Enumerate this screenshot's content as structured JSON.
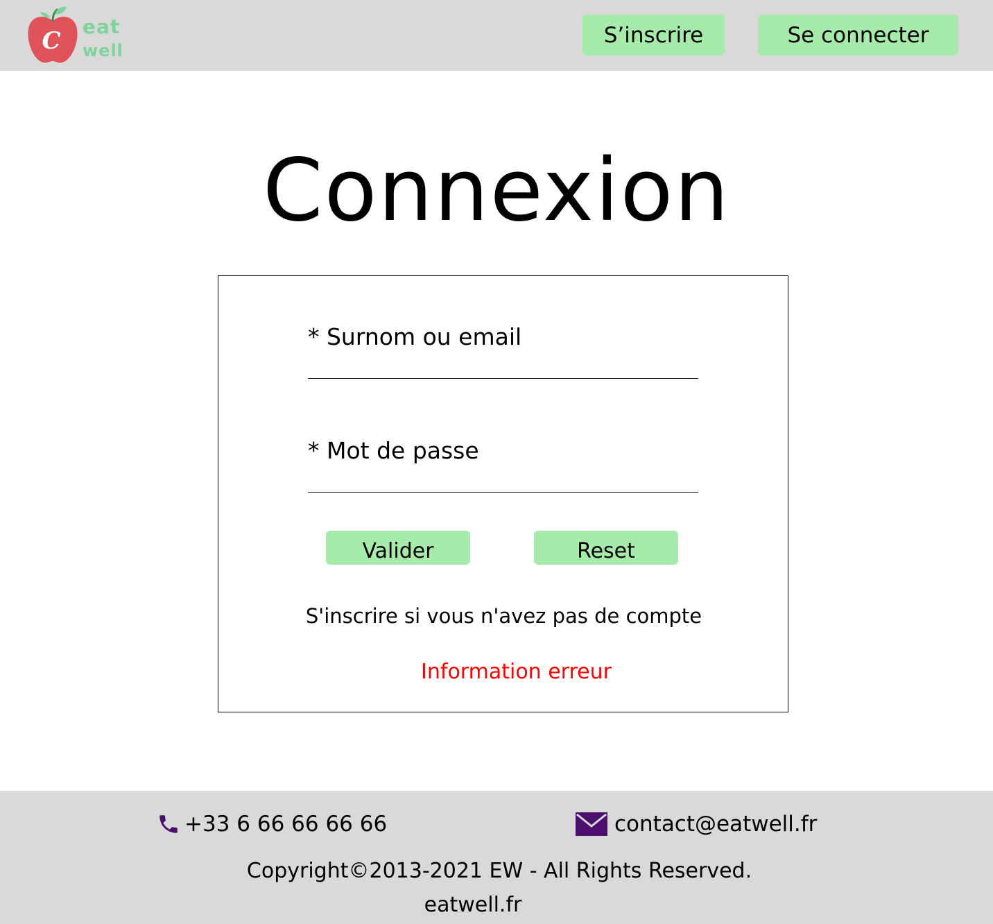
{
  "header": {
    "logo": {
      "line1": "eat",
      "line2": "well",
      "badge_letter": "C",
      "apple_color": "#e0525a",
      "leaf_color": "#7ed39a"
    },
    "nav": {
      "signup_label": "S’inscrire",
      "login_label": "Se connecter"
    },
    "button_color": "#a6ebaa",
    "background": "#d9d9d9"
  },
  "main": {
    "title": "Connexion",
    "form": {
      "username_label": "* Surnom ou email",
      "username_value": "",
      "password_label": "* Mot de passe",
      "password_value": "",
      "submit_label": "Valider",
      "reset_label": "Reset",
      "signup_link": "S'inscrire si vous n'avez pas de compte",
      "error_text": "Information erreur",
      "error_color": "#ff0000"
    }
  },
  "footer": {
    "phone": "+33 6 66 66 66 66",
    "email": "contact@eatwell.fr",
    "icon_color": "#4b0f6e",
    "copyright": "Copyright©2013-2021 EW - All Rights Reserved.",
    "site": "eatwell.fr",
    "icons": [
      "phone-icon",
      "mail-icon"
    ]
  }
}
